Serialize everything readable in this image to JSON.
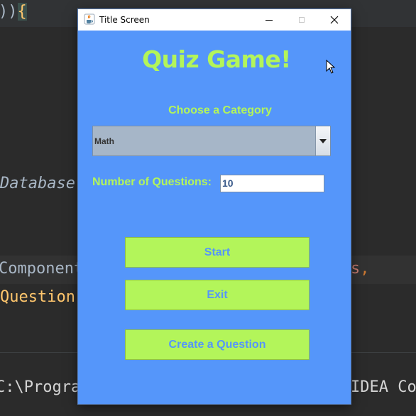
{
  "background_editor": {
    "line_top_prefix": "))",
    "line_top_brace": "{",
    "database_fragment": "Database",
    "component_fragment": "Component",
    "question_fragment": "Question",
    "right_fragment_name": "s",
    "right_fragment_comma": ",",
    "console_left": "C:\\Progra",
    "console_right": "IDEA Co"
  },
  "window": {
    "title": "Title Screen",
    "controls": {
      "close_glyph": "✕"
    }
  },
  "main": {
    "heading": "Quiz Game!",
    "category_label": "Choose a Category",
    "category_selected": "Math",
    "num_questions_label": "Number of Questions:",
    "num_questions_value": "10",
    "buttons": {
      "start": "Start",
      "exit": "Exit",
      "create": "Create a Question"
    }
  },
  "colors": {
    "panel_bg": "#5596fa",
    "accent_green": "#b3f55a",
    "combo_bg": "#a6b6c8"
  }
}
